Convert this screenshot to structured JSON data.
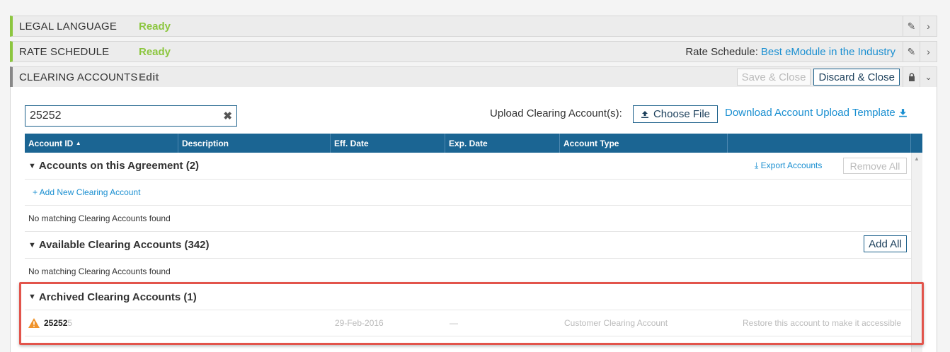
{
  "sections": [
    {
      "name": "LEGAL LANGUAGE",
      "status": "Ready"
    },
    {
      "name": "RATE SCHEDULE",
      "status": "Ready",
      "rate_label": "Rate Schedule:",
      "rate_value": "Best eModule in the Industry"
    },
    {
      "name": "CLEARING ACCOUNTS",
      "status": "Edit",
      "save_label": "Save & Close",
      "discard_label": "Discard & Close"
    }
  ],
  "search": {
    "value": "25252",
    "clear_glyph": "✖"
  },
  "upload": {
    "label": "Upload Clearing Account(s):",
    "choose_file": "Choose File",
    "download_template": "Download Account Upload Template"
  },
  "grid": {
    "columns": [
      "Account ID",
      "Description",
      "Eff. Date",
      "Exp. Date",
      "Account Type",
      ""
    ],
    "sort_indicator": "▲",
    "groups": [
      {
        "title": "Accounts on this Agreement (2)",
        "export_label": "Export Accounts",
        "remove_all_label": "Remove All",
        "add_new_label": "+ Add New Clearing Account",
        "empty_message": "No matching Clearing Accounts found"
      },
      {
        "title": "Available Clearing Accounts (342)",
        "add_all_label": "Add All",
        "empty_message": "No matching Clearing Accounts found"
      },
      {
        "title": "Archived Clearing Accounts (1)",
        "rows": [
          {
            "account_id_match": "25252",
            "account_id_rest": "5",
            "eff_date": "29-Feb-2016",
            "exp_date": "—",
            "account_type": "Customer Clearing Account",
            "note": "Restore this account to make it accessible"
          }
        ]
      }
    ]
  },
  "colors": {
    "ready": "#8cc63f",
    "link": "#1a8fd1",
    "header_bg": "#1b6593",
    "highlight": "#e2544b",
    "warning": "#f0932b"
  }
}
